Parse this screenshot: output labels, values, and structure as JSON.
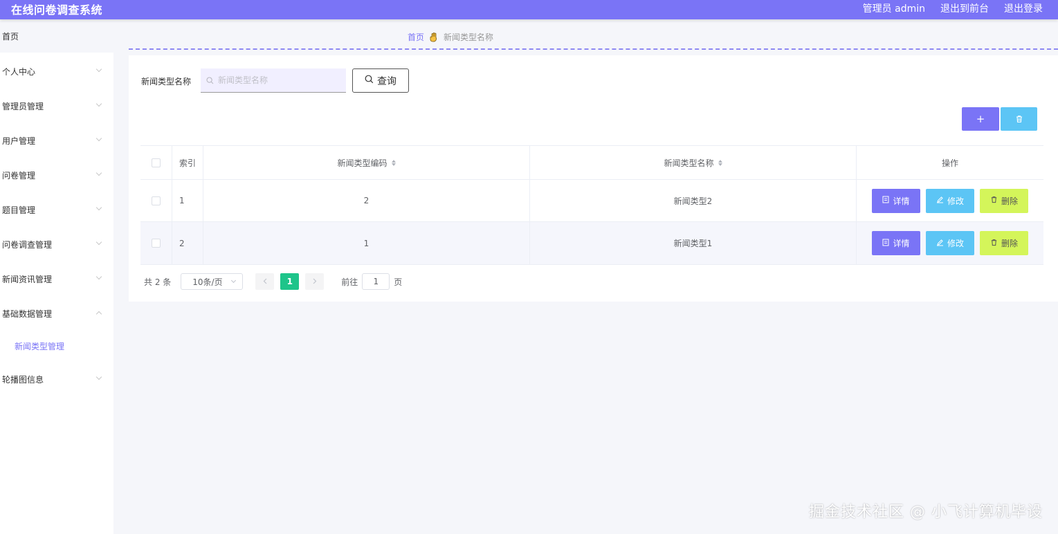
{
  "header": {
    "title": "在线问卷调查系统",
    "user": "管理员 admin",
    "to_front": "退出到前台",
    "logout": "退出登录"
  },
  "sidebar": {
    "home": "首页",
    "items": [
      {
        "label": "个人中心",
        "expanded": false
      },
      {
        "label": "管理员管理",
        "expanded": false
      },
      {
        "label": "用户管理",
        "expanded": false
      },
      {
        "label": "问卷管理",
        "expanded": false
      },
      {
        "label": "题目管理",
        "expanded": false
      },
      {
        "label": "问卷调查管理",
        "expanded": false
      },
      {
        "label": "新闻资讯管理",
        "expanded": false
      },
      {
        "label": "基础数据管理",
        "expanded": true
      },
      {
        "label": "轮播图信息",
        "expanded": false
      }
    ],
    "sub_item": "新闻类型管理"
  },
  "breadcrumb": {
    "home": "首页",
    "current": "新闻类型名称"
  },
  "search": {
    "label": "新闻类型名称",
    "placeholder": "新闻类型名称",
    "value": "",
    "button": "查询"
  },
  "toolbar": {
    "add_label": "+"
  },
  "table": {
    "columns": [
      "索引",
      "新闻类型编码",
      "新闻类型名称",
      "操作"
    ],
    "rows": [
      {
        "index": "1",
        "code": "2",
        "name": "新闻类型2"
      },
      {
        "index": "2",
        "code": "1",
        "name": "新闻类型1"
      }
    ],
    "actions": {
      "detail": "详情",
      "edit": "修改",
      "delete": "删除"
    }
  },
  "pagination": {
    "total": "共 2 条",
    "page_size": "10条/页",
    "current_page": "1",
    "goto_prefix": "前往",
    "goto_value": "1",
    "goto_suffix": "页"
  },
  "watermark": "掘金技术社区 @ 小飞计算机毕设",
  "colors": {
    "primary": "#7a74f6",
    "edit": "#5cc5f5",
    "delete": "#d4f55a",
    "active_page": "#1ec48a"
  }
}
